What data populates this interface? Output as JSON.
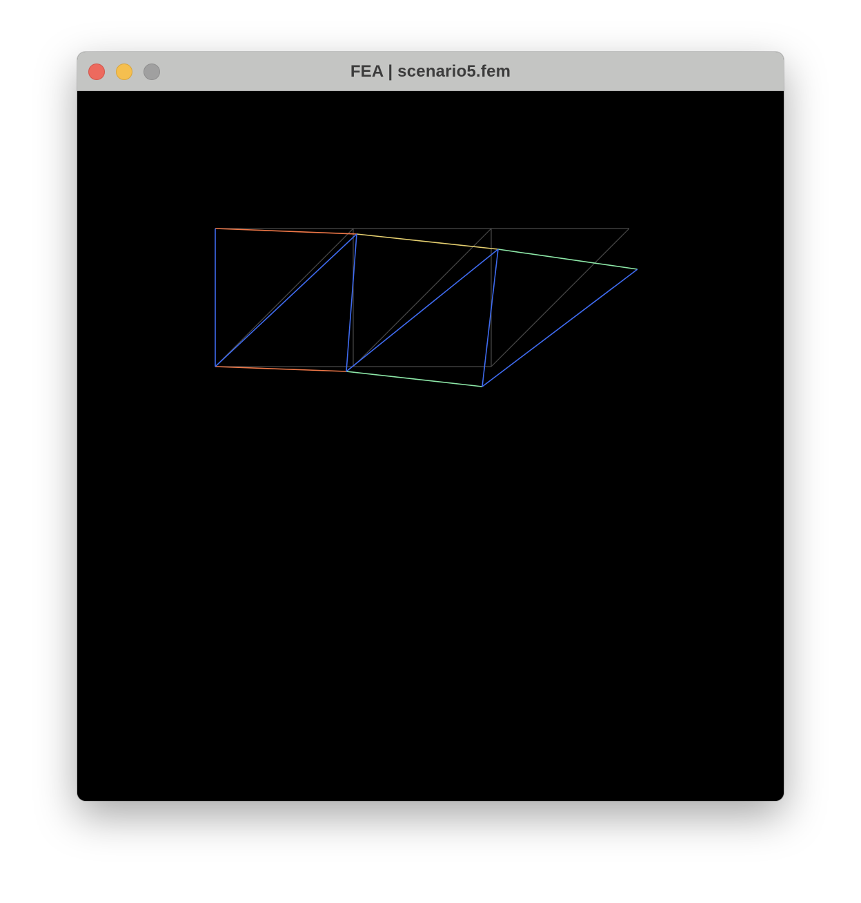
{
  "window": {
    "title": "FEA | scenario5.fem"
  },
  "traffic_lights": [
    {
      "name": "close",
      "color": "#ed6a5e"
    },
    {
      "name": "minimize",
      "color": "#f5bf4f"
    },
    {
      "name": "zoom",
      "color": "#a0a0a0"
    }
  ],
  "viewport": {
    "background": "#000000",
    "undeformed_color": "#4a4a4a"
  }
}
